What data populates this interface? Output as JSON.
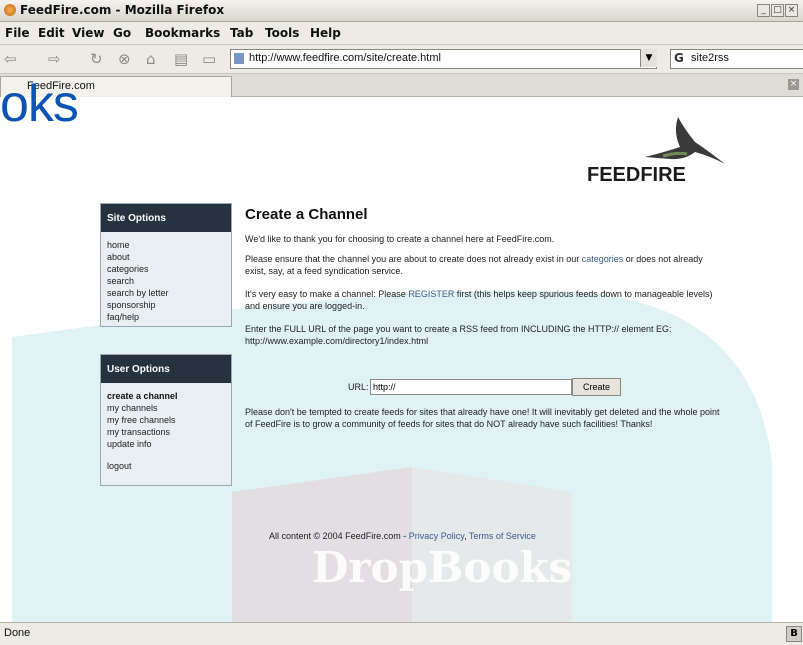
{
  "window": {
    "title": "FeedFire.com - Mozilla Firefox"
  },
  "menu": [
    "File",
    "Edit",
    "View",
    "Go",
    "Bookmarks",
    "Tab",
    "Tools",
    "Help"
  ],
  "toolbar": {
    "url": "http://www.feedfire.com/site/create.html",
    "search_value": "site2rss"
  },
  "tab": {
    "label": "FeedFire.com"
  },
  "watermark": {
    "partial": "oks",
    "band": "DropBooks"
  },
  "logo": {
    "text": "FEEDFIRE"
  },
  "site_options": {
    "title": "Site Options",
    "items": [
      "home",
      "about",
      "categories",
      "search",
      "search by letter",
      "sponsorship",
      "faq/help"
    ]
  },
  "user_options": {
    "title": "User Options",
    "items": [
      "create a channel",
      "my channels",
      "my free channels",
      "my transactions",
      "update info",
      "logout"
    ]
  },
  "main": {
    "heading": "Create a Channel",
    "p1": "We'd like to thank you for choosing to create a channel here at FeedFire.com.",
    "p2a": "Please ensure that the channel you are about to create does not already exist in our ",
    "p2link": "categories",
    "p2b": " or does not already exist, say, at a feed syndication service.",
    "p3a": "It's very easy to make a channel: Please ",
    "p3link": "REGISTER",
    "p3b": " first (this helps keep spurious feeds down to manageable levels) and ensure you are logged-in.",
    "p4": "Enter the FULL URL of the page you want to create a RSS feed from INCLUDING the HTTP:// element EG: http://www.example.com/directory1/index.html",
    "url_label": "URL:",
    "url_value": "http://",
    "create_label": "Create",
    "p5": "Please don't be tempted to create feeds for sites that already have one! It will inevitably get deleted and the whole point of FeedFire is to grow a community of feeds for sites that do NOT already have such facilities! Thanks!",
    "footer_a": "All content © 2004 FeedFire.com - ",
    "privacy": "Privacy Policy",
    "sep": ", ",
    "terms": "Terms of Service"
  },
  "status": {
    "text": "Done"
  }
}
